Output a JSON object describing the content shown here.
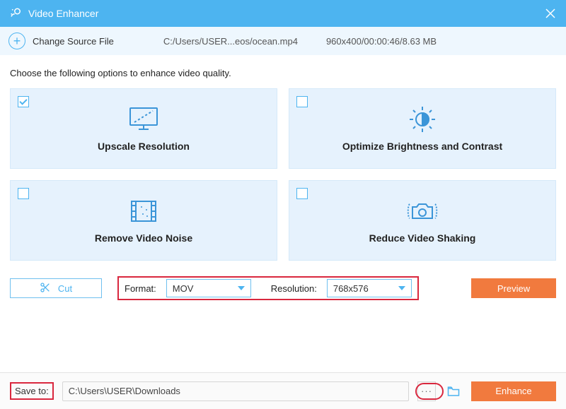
{
  "titlebar": {
    "title": "Video Enhancer"
  },
  "source": {
    "change_label": "Change Source File",
    "path": "C:/Users/USER...eos/ocean.mp4",
    "meta": "960x400/00:00:46/8.63 MB"
  },
  "instruction": "Choose the following options to enhance video quality.",
  "cards": {
    "upscale": {
      "label": "Upscale Resolution",
      "checked": true
    },
    "brightness": {
      "label": "Optimize Brightness and Contrast",
      "checked": false
    },
    "noise": {
      "label": "Remove Video Noise",
      "checked": false
    },
    "shaking": {
      "label": "Reduce Video Shaking",
      "checked": false
    }
  },
  "controls": {
    "cut_label": "Cut",
    "format_label": "Format:",
    "format_value": "MOV",
    "resolution_label": "Resolution:",
    "resolution_value": "768x576",
    "preview_label": "Preview"
  },
  "bottom": {
    "save_label": "Save to:",
    "save_path": "C:\\Users\\USER\\Downloads",
    "browse_dots": "···",
    "enhance_label": "Enhance"
  }
}
